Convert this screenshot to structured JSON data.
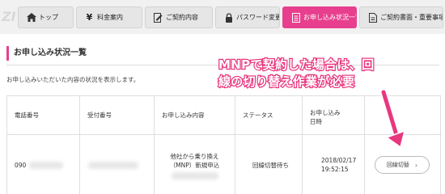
{
  "nav": {
    "logo": "ZI",
    "tabs": [
      {
        "icon": "home-icon",
        "label": "トップ",
        "active": false
      },
      {
        "icon": "yen-icon",
        "label": "料金案内",
        "active": false
      },
      {
        "icon": "document-edit-icon",
        "label": "ご契約内容",
        "active": false
      },
      {
        "icon": "lock-icon",
        "label": "パスワード変更",
        "active": false
      },
      {
        "icon": "document-list-icon",
        "label": "お申し込み状況一覧",
        "active": true
      },
      {
        "icon": "document-icon",
        "label": "ご契約書面・重要事項",
        "active": false
      }
    ]
  },
  "section": {
    "title": "お申し込み状況一覧",
    "description": "お申し込みいただいた内容の状況を表示します。"
  },
  "table": {
    "headers": [
      "電話番号",
      "受付番号",
      "お申し込み内容",
      "ステータス",
      "お申し込み日時",
      ""
    ],
    "rows": [
      {
        "phone_prefix": "090",
        "content_line1": "他社から乗り換え",
        "content_line2": "（MNP）新規申込",
        "status": "回線切替待ち",
        "date": "2018/02/17",
        "time": "19:52:15",
        "action_label": "回線切替"
      }
    ]
  },
  "annotation": {
    "line1": "MNPで契約した場合は、回",
    "line2": "線の切り替え作業が必要"
  },
  "colors": {
    "accent": "#e73f8d",
    "callout": "#e8377f"
  }
}
